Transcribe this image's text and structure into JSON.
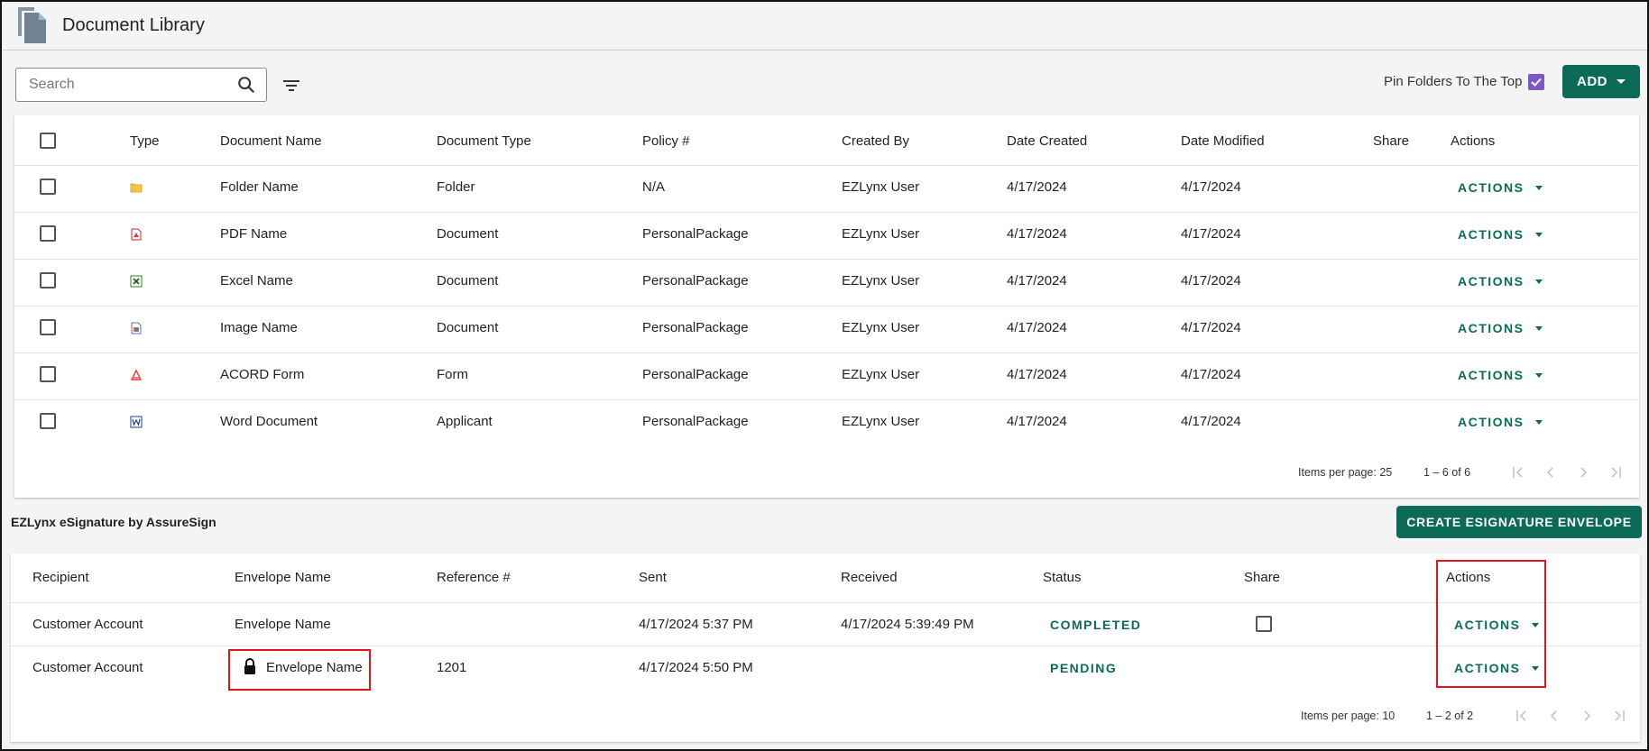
{
  "header": {
    "title": "Document Library",
    "icon": "document-stack-icon"
  },
  "toolbar": {
    "search_placeholder": "Search",
    "pin_label": "Pin Folders To The Top",
    "pin_checked": true,
    "add_label": "ADD"
  },
  "documents": {
    "columns": [
      "Type",
      "Document Name",
      "Document Type",
      "Policy #",
      "Created By",
      "Date Created",
      "Date Modified",
      "Share",
      "Actions"
    ],
    "rows": [
      {
        "icon": "folder-icon",
        "name": "Folder Name",
        "type": "Folder",
        "policy": "N/A",
        "created_by": "EZLynx User",
        "created": "4/17/2024",
        "modified": "4/17/2024",
        "action": "ACTIONS"
      },
      {
        "icon": "pdf-icon",
        "name": "PDF Name",
        "type": "Document",
        "policy": "PersonalPackage",
        "created_by": "EZLynx User",
        "created": "4/17/2024",
        "modified": "4/17/2024",
        "action": "ACTIONS"
      },
      {
        "icon": "excel-icon",
        "name": "Excel Name",
        "type": "Document",
        "policy": "PersonalPackage",
        "created_by": "EZLynx User",
        "created": "4/17/2024",
        "modified": "4/17/2024",
        "action": "ACTIONS"
      },
      {
        "icon": "image-icon",
        "name": "Image Name",
        "type": "Document",
        "policy": "PersonalPackage",
        "created_by": "EZLynx User",
        "created": "4/17/2024",
        "modified": "4/17/2024",
        "action": "ACTIONS"
      },
      {
        "icon": "acord-form-icon",
        "name": "ACORD Form",
        "type": "Form",
        "policy": "PersonalPackage",
        "created_by": "EZLynx User",
        "created": "4/17/2024",
        "modified": "4/17/2024",
        "action": "ACTIONS"
      },
      {
        "icon": "word-icon",
        "name": "Word Document",
        "type": "Applicant",
        "policy": "PersonalPackage",
        "created_by": "EZLynx User",
        "created": "4/17/2024",
        "modified": "4/17/2024",
        "action": "ACTIONS"
      }
    ],
    "pager": {
      "items_per_page": "Items per page: 25",
      "range": "1 – 6 of 6"
    }
  },
  "esignature": {
    "title": "EZLynx eSignature by AssureSign",
    "create_label": "CREATE ESIGNATURE ENVELOPE",
    "columns": [
      "Recipient",
      "Envelope Name",
      "Reference #",
      "Sent",
      "Received",
      "Status",
      "Share",
      "Actions"
    ],
    "rows": [
      {
        "recipient": "Customer Account",
        "envelope": "Envelope Name",
        "locked": false,
        "reference": "",
        "sent": "4/17/2024 5:37 PM",
        "received": "4/17/2024 5:39:49 PM",
        "status": "COMPLETED",
        "share_checkbox": true,
        "action": "ACTIONS"
      },
      {
        "recipient": "Customer Account",
        "envelope": "Envelope Name",
        "locked": true,
        "reference": "1201",
        "sent": "4/17/2024 5:50 PM",
        "received": "",
        "status": "PENDING",
        "share_checkbox": false,
        "action": "ACTIONS"
      }
    ],
    "pager": {
      "items_per_page": "Items per page: 10",
      "range": "1 – 2 of 2"
    }
  },
  "colors": {
    "accent": "#0b6b57",
    "checkbox": "#7e57c2",
    "highlight": "#e3131b"
  }
}
